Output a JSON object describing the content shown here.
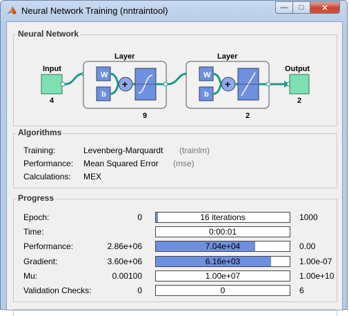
{
  "window": {
    "title": "Neural Network Training (nntraintool)",
    "controls": {
      "minimize": "—",
      "maximize": "□",
      "close": "✕"
    }
  },
  "network": {
    "section_title": "Neural Network",
    "input_label": "Input",
    "input_size": "4",
    "layers": [
      {
        "title": "Layer",
        "w": "W",
        "b": "b",
        "size": "9",
        "transfer": "tansig"
      },
      {
        "title": "Layer",
        "w": "W",
        "b": "b",
        "size": "2",
        "transfer": "purelin"
      }
    ],
    "output_label": "Output",
    "output_size": "2",
    "plus": "+"
  },
  "algorithms": {
    "section_title": "Algorithms",
    "rows": [
      {
        "label": "Training:",
        "value": "Levenberg-Marquardt",
        "note": "(trainlm)"
      },
      {
        "label": "Performance:",
        "value": "Mean Squared Error",
        "note": "(mse)"
      },
      {
        "label": "Calculations:",
        "value": "MEX",
        "note": ""
      }
    ]
  },
  "progress": {
    "section_title": "Progress",
    "rows": [
      {
        "label": "Epoch:",
        "start": "0",
        "bar_text": "16 iterations",
        "fill": 0.016,
        "end": "1000"
      },
      {
        "label": "Time:",
        "start": "",
        "bar_text": "0:00:01",
        "fill": 0,
        "end": ""
      },
      {
        "label": "Performance:",
        "start": "2.86e+06",
        "bar_text": "7.04e+04",
        "fill": 0.74,
        "end": "0.00"
      },
      {
        "label": "Gradient:",
        "start": "3.60e+06",
        "bar_text": "6.16e+03",
        "fill": 0.86,
        "end": "1.00e-07"
      },
      {
        "label": "Mu:",
        "start": "0.00100",
        "bar_text": "1.00e+07",
        "fill": 0,
        "end": "1.00e+10"
      },
      {
        "label": "Validation Checks:",
        "start": "0",
        "bar_text": "0",
        "fill": 0,
        "end": "6"
      }
    ]
  },
  "colors": {
    "node_green": "#7ee0b0",
    "weight_blue": "#6f8fe0",
    "connector": "#1b9a8a"
  }
}
